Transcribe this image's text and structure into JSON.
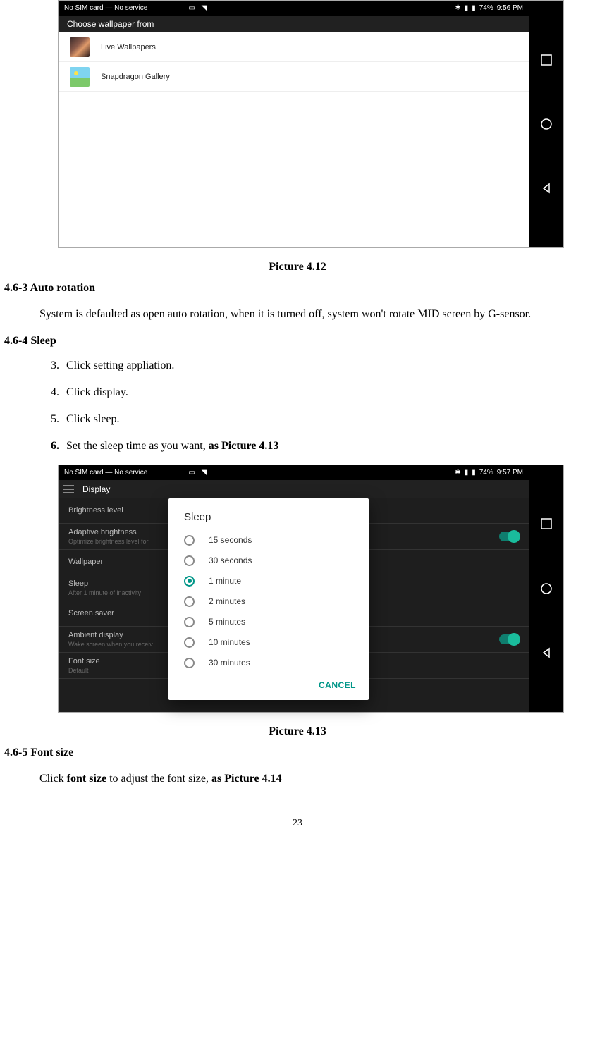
{
  "fig412": {
    "statusbar": {
      "left": "No SIM card — No service",
      "battery": "74%",
      "time": "9:56 PM"
    },
    "header": "Choose wallpaper from",
    "items": [
      "Live Wallpapers",
      "Snapdragon Gallery"
    ],
    "caption": "Picture 4.12"
  },
  "sect_463": {
    "heading": "4.6-3 Auto rotation",
    "body": "System is defaulted as open auto rotation, when it is turned off, system won't rotate MID screen by G-sensor."
  },
  "sect_464": {
    "heading": "4.6-4 Sleep",
    "steps": [
      {
        "n": "3.",
        "t": "Click setting appliation."
      },
      {
        "n": "4.",
        "t": "Click display."
      },
      {
        "n": "5.",
        "t": "Click sleep."
      },
      {
        "n": "6.",
        "t_pre": "Set the sleep time as you want, ",
        "t_bold": "as Picture 4.13"
      }
    ]
  },
  "fig413": {
    "statusbar": {
      "left": "No SIM card — No service",
      "battery": "74%",
      "time": "9:57 PM"
    },
    "header": "Display",
    "rows": [
      {
        "main": "Brightness level"
      },
      {
        "main": "Adaptive brightness",
        "sub": "Optimize brightness level for",
        "toggle": true
      },
      {
        "main": "Wallpaper"
      },
      {
        "main": "Sleep",
        "sub": "After 1 minute of inactivity"
      },
      {
        "main": "Screen saver"
      },
      {
        "main": "Ambient display",
        "sub": "Wake screen when you receiv",
        "toggle": true
      },
      {
        "main": "Font size",
        "sub": "Default"
      }
    ],
    "dialog": {
      "title": "Sleep",
      "options": [
        "15 seconds",
        "30 seconds",
        "1 minute",
        "2 minutes",
        "5 minutes",
        "10 minutes",
        "30 minutes"
      ],
      "selected_index": 2,
      "cancel": "CANCEL"
    },
    "caption": "Picture 4.13"
  },
  "sect_465": {
    "heading": "4.6-5 Font size",
    "body_pre": "Click ",
    "body_b1": "font size",
    "body_mid": " to adjust the font size, ",
    "body_b2": "as Picture 4.14"
  },
  "pagenum": "23"
}
